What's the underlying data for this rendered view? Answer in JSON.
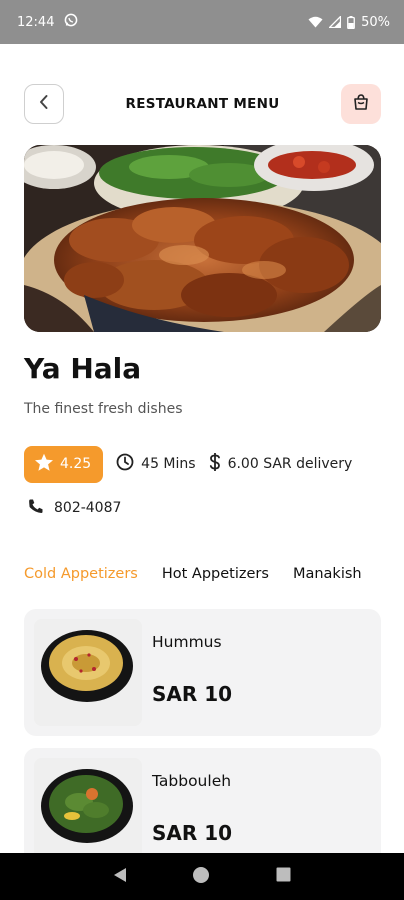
{
  "status": {
    "time": "12:44",
    "battery": "50%"
  },
  "header": {
    "title": "RESTAURANT MENU"
  },
  "restaurant": {
    "name": "Ya Hala",
    "tagline": "The finest fresh dishes",
    "rating": "4.25",
    "time": "45 Mins",
    "delivery": "6.00 SAR delivery",
    "phone": "802-4087"
  },
  "tabs": [
    {
      "label": "Cold Appetizers",
      "active": true
    },
    {
      "label": "Hot Appetizers",
      "active": false
    },
    {
      "label": "Manakish",
      "active": false
    }
  ],
  "menu_items": [
    {
      "name": "Hummus",
      "price": "SAR 10"
    },
    {
      "name": "Tabbouleh",
      "price": "SAR 10"
    }
  ],
  "colors": {
    "accent": "#f59a2c",
    "cart_bg": "#fde0da",
    "card_bg": "#f3f3f4"
  }
}
